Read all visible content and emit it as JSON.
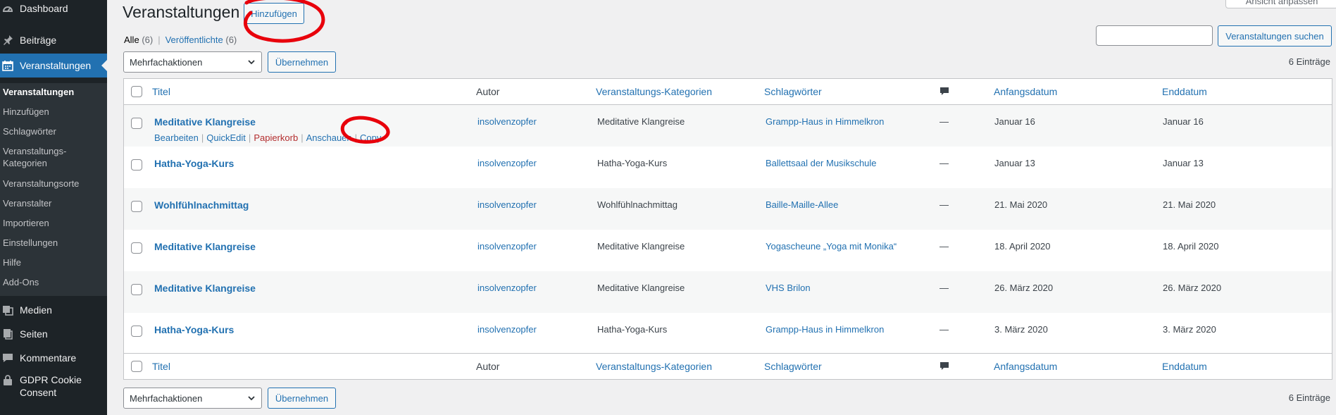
{
  "sidebar": {
    "top_items": [
      {
        "label": "Dashboard",
        "icon": "dashboard-icon"
      },
      {
        "label": "Beiträge",
        "icon": "pin-icon"
      },
      {
        "label": "Veranstaltungen",
        "icon": "calendar-icon"
      }
    ],
    "submenu": [
      "Veranstaltungen",
      "Hinzufügen",
      "Schlagwörter",
      "Veranstaltungs-Kategorien",
      "Veranstaltungsorte",
      "Veranstalter",
      "Importieren",
      "Einstellungen",
      "Hilfe",
      "Add-Ons"
    ],
    "bottom_items": [
      {
        "label": "Medien",
        "icon": "media-icon"
      },
      {
        "label": "Seiten",
        "icon": "pages-icon"
      },
      {
        "label": "Kommentare",
        "icon": "comments-icon"
      },
      {
        "label": "GDPR Cookie Consent",
        "icon": "lock-icon"
      }
    ]
  },
  "header": {
    "title": "Veranstaltungen",
    "add_new": "Hinzufügen",
    "screen_options": "Ansicht anpassen"
  },
  "views": {
    "all": "Alle",
    "all_count": "(6)",
    "published": "Veröffentlichte",
    "published_count": "(6)"
  },
  "search": {
    "placeholder": "",
    "button": "Veranstaltungen suchen"
  },
  "bulk": {
    "select": "Mehrfachaktionen",
    "apply": "Übernehmen",
    "count": "6 Einträge"
  },
  "columns": {
    "title": "Titel",
    "author": "Autor",
    "categories": "Veranstaltungs-Kategorien",
    "tags": "Schlagwörter",
    "start": "Anfangsdatum",
    "end": "Enddatum"
  },
  "row_actions": {
    "edit": "Bearbeiten",
    "quickedit": "QuickEdit",
    "trash": "Papierkorb",
    "view": "Anschauen",
    "copy": "Copy"
  },
  "rows": [
    {
      "title": "Meditative Klangreise",
      "author": "insolvenzopfer",
      "category": "Meditative Klangreise",
      "tag": "Grampp-Haus in Himmelkron",
      "comments": "—",
      "start": "Januar 16",
      "end": "Januar 16"
    },
    {
      "title": "Hatha-Yoga-Kurs",
      "author": "insolvenzopfer",
      "category": "Hatha-Yoga-Kurs",
      "tag": "Ballettsaal der Musikschule",
      "comments": "—",
      "start": "Januar 13",
      "end": "Januar 13"
    },
    {
      "title": "Wohlfühlnachmittag",
      "author": "insolvenzopfer",
      "category": "Wohlfühlnachmittag",
      "tag": "Baille-Maille-Allee",
      "comments": "—",
      "start": "21. Mai 2020",
      "end": "21. Mai 2020"
    },
    {
      "title": "Meditative Klangreise",
      "author": "insolvenzopfer",
      "category": "Meditative Klangreise",
      "tag": "Yogascheune  „Yoga mit Monika“",
      "comments": "—",
      "start": "18. April 2020",
      "end": "18. April 2020"
    },
    {
      "title": "Meditative Klangreise",
      "author": "insolvenzopfer",
      "category": "Meditative Klangreise",
      "tag": "VHS Brilon",
      "comments": "—",
      "start": "26. März 2020",
      "end": "26. März 2020"
    },
    {
      "title": "Hatha-Yoga-Kurs",
      "author": "insolvenzopfer",
      "category": "Hatha-Yoga-Kurs",
      "tag": "Grampp-Haus in Himmelkron",
      "comments": "—",
      "start": "3. März 2020",
      "end": "3. März 2020"
    }
  ],
  "colors": {
    "accent": "#2271b1",
    "sidebar": "#1d2327",
    "annotation": "#e8000b"
  }
}
